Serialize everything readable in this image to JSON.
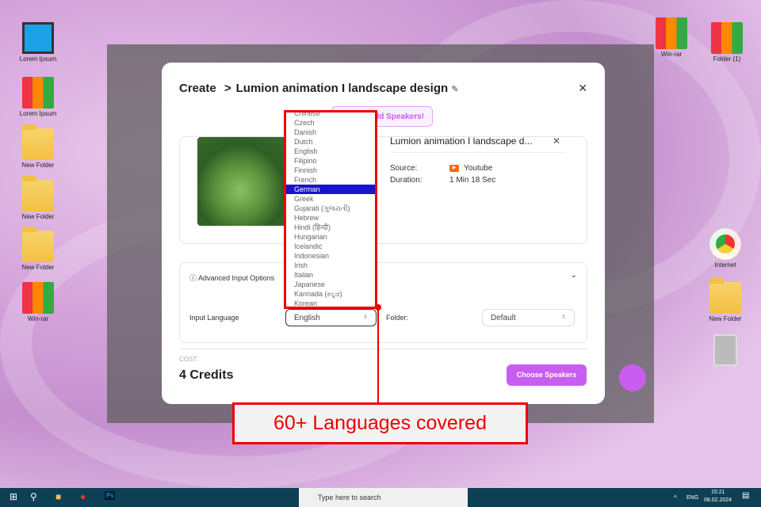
{
  "desktop": {
    "left": [
      "Lorem Ipsum",
      "Lorem Ipsum",
      "New Folder",
      "New Folder",
      "New Folder",
      "Win-rar"
    ],
    "right": [
      "Win-rar",
      "Folder (1)",
      "Internet",
      "New Folder"
    ]
  },
  "modal": {
    "crumb_root": "Create",
    "crumb_sep": ">",
    "title": "Lumion animation I landscape design",
    "add_speakers": "Add Speakers!",
    "video": {
      "title": "Lumion animation I landscape d...",
      "source_label": "Source:",
      "source_value": "Youtube",
      "duration_label": "Duration:",
      "duration_value": "1 Min 18 Sec"
    },
    "advanced_label": "Advanced Input Options",
    "input_language_label": "Input Language",
    "input_language_value": "English",
    "folder_label": "Folder:",
    "folder_value": "Default",
    "cost_label": "COST:",
    "credits": "4 Credits",
    "choose_button": "Choose Speakers"
  },
  "languages": [
    "Chinese",
    "Czech",
    "Danish",
    "Dutch",
    "English",
    "Filipino",
    "Finnish",
    "French",
    "German",
    "Greek",
    "Gujarati (ગુજરાતી)",
    "Hebrew",
    "Hindi (हिन्दी)",
    "Hungarian",
    "Icelandic",
    "Indonesian",
    "Irish",
    "Italian",
    "Japanese",
    "Kannada (ಕನ್ನಡ)",
    "Korean"
  ],
  "selected_language": "German",
  "callout": "60+ Languages covered",
  "taskbar": {
    "search_placeholder": "Type here to search",
    "lang": "ENG",
    "time": "15:21",
    "date": "08.02.2024"
  }
}
